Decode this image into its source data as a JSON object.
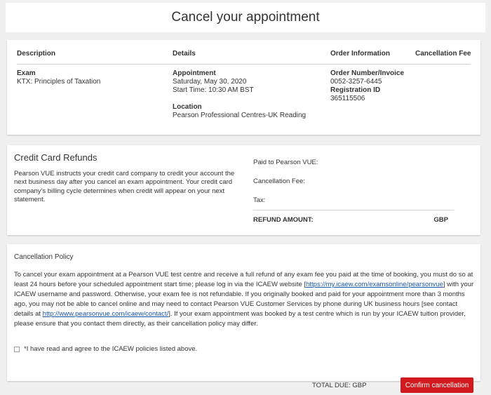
{
  "header": {
    "title": "Cancel your appointment"
  },
  "appointment_table": {
    "headers": {
      "description": "Description",
      "details": "Details",
      "order_information": "Order Information",
      "cancellation_fee": "Cancellation Fee"
    },
    "description": {
      "label": "Exam",
      "value": "KTX: Principles of Taxation"
    },
    "details": {
      "appointment_label": "Appointment",
      "date": "Saturday, May 30, 2020",
      "start_time": "Start Time: 10:30 AM BST",
      "location_label": "Location",
      "location": "Pearson Professional Centres-UK Reading"
    },
    "order_information": {
      "order_label": "Order Number/Invoice",
      "order_number": "0052-3257-6445",
      "registration_label": "Registration ID",
      "registration_id": "365115506"
    }
  },
  "refunds": {
    "title": "Credit Card Refunds",
    "description": "Pearson VUE instructs your credit card company to credit your account the next business day after you cancel an exam appointment. Your credit card company's billing cycle determines when credit will appear on your next statement.",
    "paid_label": "Paid to Pearson VUE:",
    "fee_label": "Cancellation Fee:",
    "tax_label": "Tax:",
    "refund_label": "REFUND AMOUNT:",
    "refund_currency": "GBP"
  },
  "policy": {
    "title": "Cancellation Policy",
    "text_1": "To cancel your exam appointment at a Pearson VUE test centre and receive a full refund of any exam fee you paid at the time of booking, you must do so at least 24 hours before your scheduled appointment start time; please log in via the ICAEW website [",
    "link_1": "https://my.icaew.com/examsonline/pearsonvue",
    "text_2": "] with your ICAEW username and password. Otherwise, your exam fee is not refundable. If you originally booked and paid for your appointment more than 3 months ago, you may not be able to cancel online and may need to contact Pearson VUE Customer Services by phone during UK business hours [see contact details at ",
    "link_2": "http://www.pearsonvue.com/icaew/contact/",
    "text_3": "]. If your exam appointment was booked by a test centre which is run by your ICAEW tuition provider, please ensure that you contact them directly, as their cancellation policy may differ.",
    "agree_label": "*I have read and agree to the ICAEW policies listed above."
  },
  "footer": {
    "total_due": "TOTAL DUE: GBP",
    "confirm_label": "Confirm cancellation"
  },
  "colors": {
    "accent": "#d2191e",
    "link": "#1a55a8"
  }
}
